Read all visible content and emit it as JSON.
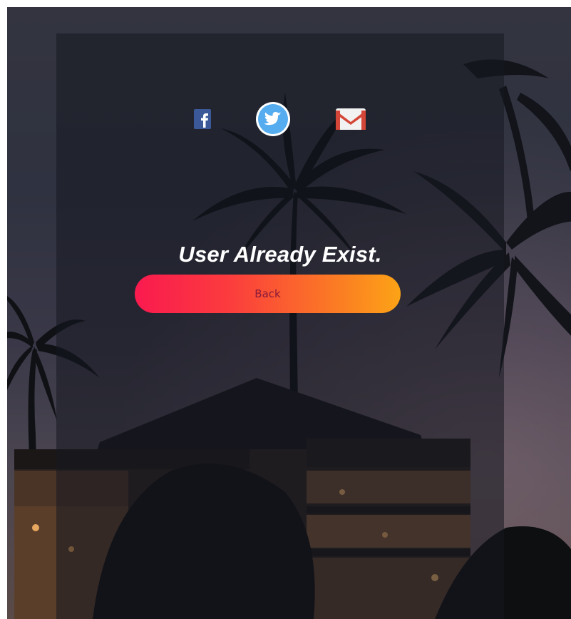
{
  "social": {
    "facebook_icon": "facebook-icon",
    "twitter_icon": "twitter-icon",
    "gmail_icon": "gmail-icon"
  },
  "message": "User Already Exist.",
  "back_button": {
    "label": "Back"
  },
  "colors": {
    "button_gradient_start": "#fa1a4f",
    "button_gradient_end": "#fca316",
    "facebook": "#3b5998",
    "twitter": "#55acee",
    "gmail": "#d44638"
  }
}
